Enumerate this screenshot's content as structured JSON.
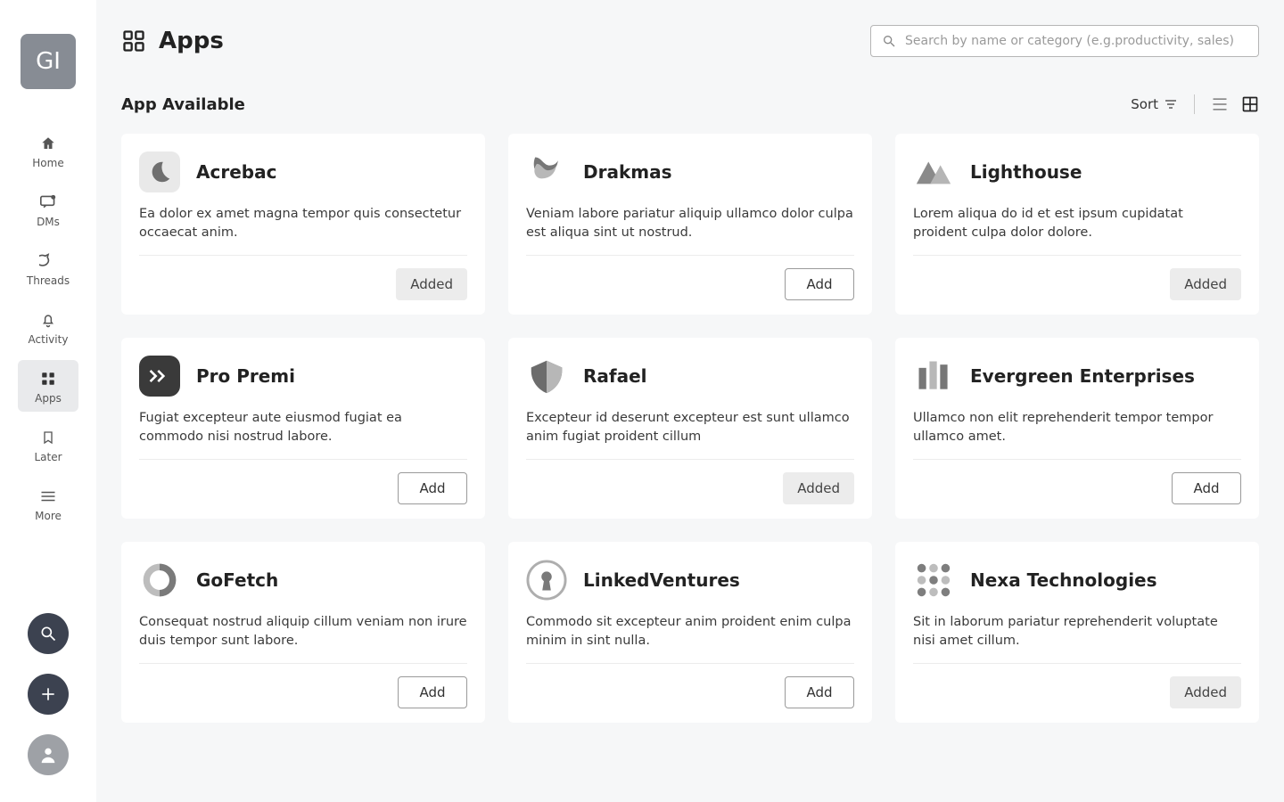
{
  "brand_initials": "GI",
  "sidebar": {
    "items": [
      {
        "key": "home",
        "label": "Home"
      },
      {
        "key": "dms",
        "label": "DMs"
      },
      {
        "key": "threads",
        "label": "Threads"
      },
      {
        "key": "activity",
        "label": "Activity"
      },
      {
        "key": "apps",
        "label": "Apps"
      },
      {
        "key": "later",
        "label": "Later"
      },
      {
        "key": "more",
        "label": "More"
      }
    ],
    "active_key": "apps"
  },
  "page": {
    "title": "Apps",
    "search_placeholder": "Search by name or category (e.g.productivity, sales)",
    "section_title": "App Available",
    "sort_label": "Sort",
    "button_labels": {
      "add": "Add",
      "added": "Added"
    }
  },
  "apps": [
    {
      "name": "Acrebac",
      "desc": "Ea dolor ex amet magna tempor quis consectetur occaecat anim.",
      "status": "added",
      "logo": "moon"
    },
    {
      "name": "Drakmas",
      "desc": "Veniam labore pariatur aliquip ullamco dolor culpa est aliqua sint ut nostrud.",
      "status": "add",
      "logo": "ribbon"
    },
    {
      "name": "Lighthouse",
      "desc": "Lorem aliqua do id et est ipsum cupidatat proident culpa dolor dolore.",
      "status": "added",
      "logo": "peaks"
    },
    {
      "name": "Pro Premi",
      "desc": "Fugiat excepteur aute eiusmod fugiat ea commodo nisi nostrud labore.",
      "status": "add",
      "logo": "forward"
    },
    {
      "name": "Rafael",
      "desc": "Excepteur id deserunt excepteur est sunt ullamco anim fugiat proident cillum",
      "status": "added",
      "logo": "shield"
    },
    {
      "name": "Evergreen Enterprises",
      "desc": "Ullamco non elit reprehenderit tempor tempor ullamco amet.",
      "status": "add",
      "logo": "bars"
    },
    {
      "name": "GoFetch",
      "desc": "Consequat nostrud aliquip cillum veniam non irure duis tempor sunt labore.",
      "status": "add",
      "logo": "ring"
    },
    {
      "name": "LinkedVentures",
      "desc": "Commodo sit excepteur anim proident enim culpa minim in sint nulla.",
      "status": "add",
      "logo": "keyhole"
    },
    {
      "name": "Nexa Technologies",
      "desc": "Sit in laborum pariatur reprehenderit voluptate nisi amet cillum.",
      "status": "added",
      "logo": "mesh"
    }
  ]
}
